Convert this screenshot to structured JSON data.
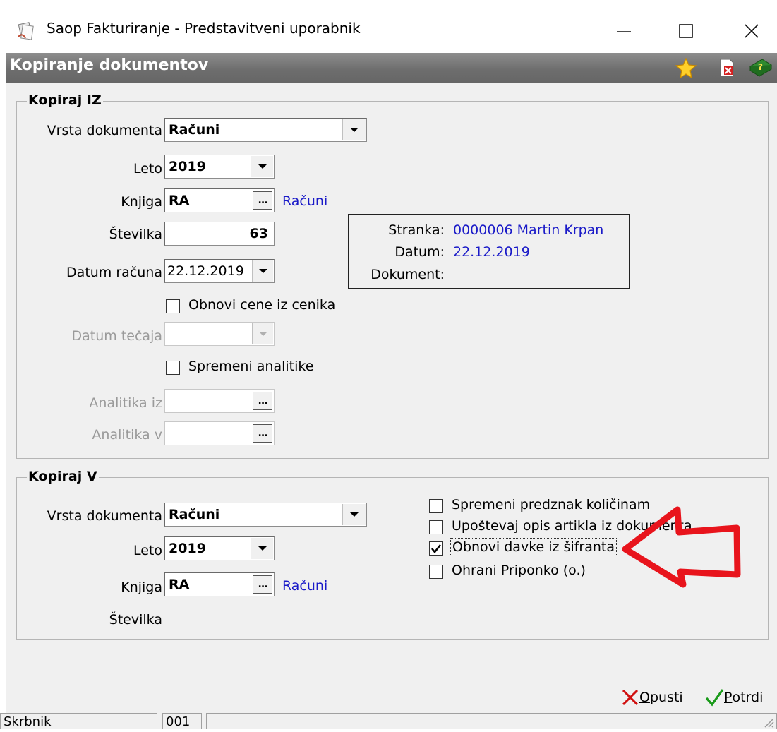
{
  "window": {
    "title": "Saop Fakturiranje - Predstavitveni uporabnik",
    "minimize": "—",
    "maximize": "☐",
    "close": "✕"
  },
  "header": {
    "title": "Kopiranje dokumentov",
    "icons": [
      "star-icon",
      "delete-document-icon",
      "help-icon"
    ]
  },
  "kopiraj_iz": {
    "title": "Kopiraj IZ",
    "vrsta_label": "Vrsta dokumenta",
    "vrsta_value": "Računi",
    "leto_label": "Leto",
    "leto_value": "2019",
    "knjiga_label": "Knjiga",
    "knjiga_value": "RA",
    "knjiga_ellipsis": "...",
    "knjiga_name": "Računi",
    "stevilka_label": "Številka",
    "stevilka_value": "63",
    "datum_label": "Datum računa",
    "datum_value": "22.12.2019",
    "obnovi_cene": "Obnovi cene iz cenika",
    "obnovi_cene_checked": false,
    "datum_tecaja_label": "Datum tečaja",
    "spremeni_analitike": "Spremeni analitike",
    "spremeni_analitike_checked": false,
    "analitika_iz_label": "Analitika iz",
    "analitika_v_label": "Analitika v",
    "analitika_ellipsis": "..."
  },
  "info": {
    "stranka_label": "Stranka:",
    "stranka_value": "0000006  Martin Krpan",
    "datum_label": "Datum:",
    "datum_value": "22.12.2019",
    "dokument_label": "Dokument:"
  },
  "kopiraj_v": {
    "title": "Kopiraj V",
    "vrsta_label": "Vrsta dokumenta",
    "vrsta_value": "Računi",
    "leto_label": "Leto",
    "leto_value": "2019",
    "knjiga_label": "Knjiga",
    "knjiga_value": "RA",
    "knjiga_ellipsis": "...",
    "knjiga_name": "Računi",
    "stevilka_label": "Številka",
    "options": [
      {
        "label": "Spremeni predznak količinam",
        "checked": false
      },
      {
        "label": "Upoštevaj opis artikla iz dokumenta",
        "checked": false
      },
      {
        "label": "Obnovi davke iz šifranta",
        "checked": true
      },
      {
        "label": "Ohrani Priponko (o.)",
        "checked": false
      }
    ]
  },
  "footer": {
    "cancel_rest": "pusti",
    "cancel_key": "O",
    "confirm_rest": "otrdi",
    "confirm_key": "P"
  },
  "statusbar": {
    "user": "Skrbnik",
    "code": "001"
  },
  "colors": {
    "header_gradient": "#7a7a7a",
    "link_blue": "#1a1ac8",
    "arrow_red": "#e8141c",
    "cancel_red": "#d01010",
    "confirm_green": "#1a9a1a"
  }
}
